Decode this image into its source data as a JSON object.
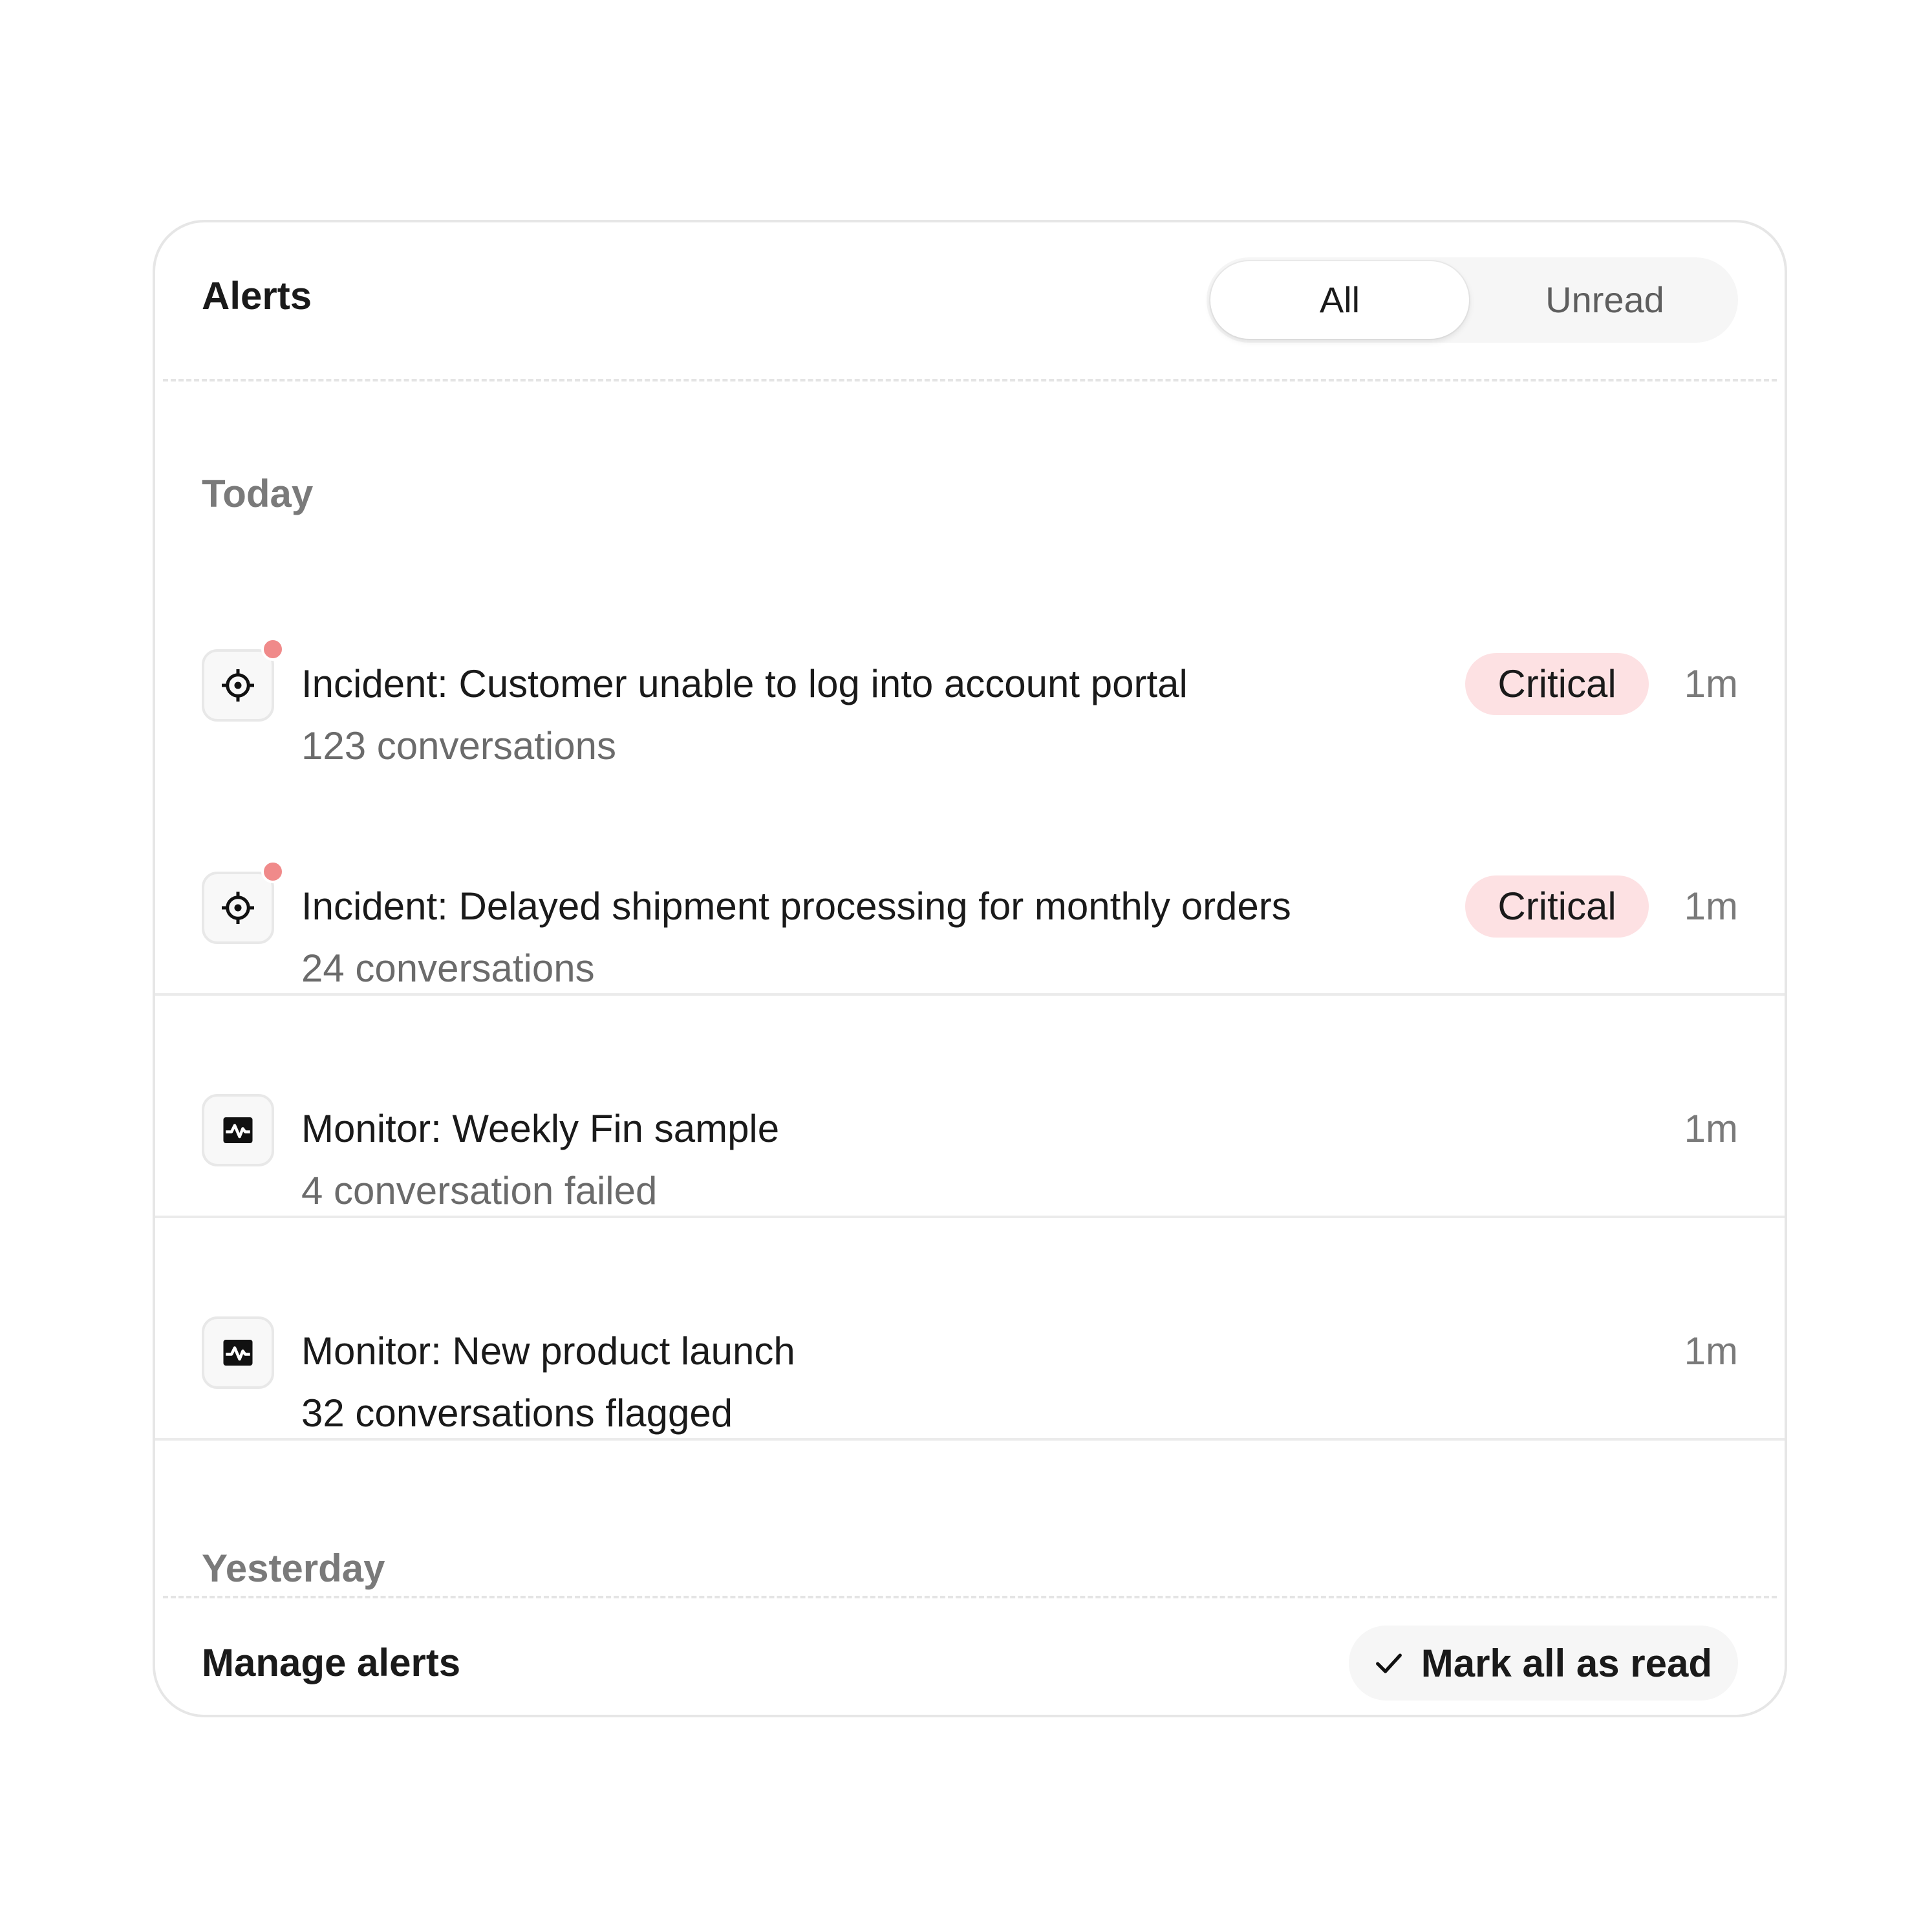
{
  "header": {
    "title": "Alerts",
    "tabs": [
      {
        "label": "All",
        "selected": true
      },
      {
        "label": "Unread",
        "selected": false
      }
    ]
  },
  "sections": [
    {
      "label": "Today",
      "alerts": [
        {
          "icon": "crosshair-icon",
          "unread": true,
          "title": "Incident: Customer unable to log into account portal",
          "subtitle": "123 conversations",
          "severity": "Critical",
          "time": "1m"
        },
        {
          "icon": "crosshair-icon",
          "unread": true,
          "title": "Incident: Delayed shipment processing for monthly orders",
          "subtitle": "24 conversations",
          "severity": "Critical",
          "time": "1m"
        },
        {
          "icon": "monitor-pulse-icon",
          "unread": false,
          "title": "Monitor: Weekly Fin sample",
          "subtitle": "4 conversation failed",
          "time": "1m"
        },
        {
          "icon": "monitor-pulse-icon",
          "unread": false,
          "title": "Monitor: New product launch",
          "subtitle": "32 conversations flagged",
          "time": "1m"
        }
      ]
    },
    {
      "label": "Yesterday",
      "alerts": []
    }
  ],
  "footer": {
    "manage_label": "Manage alerts",
    "mark_all_label": "Mark all as read"
  },
  "colors": {
    "critical_badge_bg": "#fde1e3",
    "unread_dot": "#f08a8a",
    "border": "#e6e6e6"
  }
}
